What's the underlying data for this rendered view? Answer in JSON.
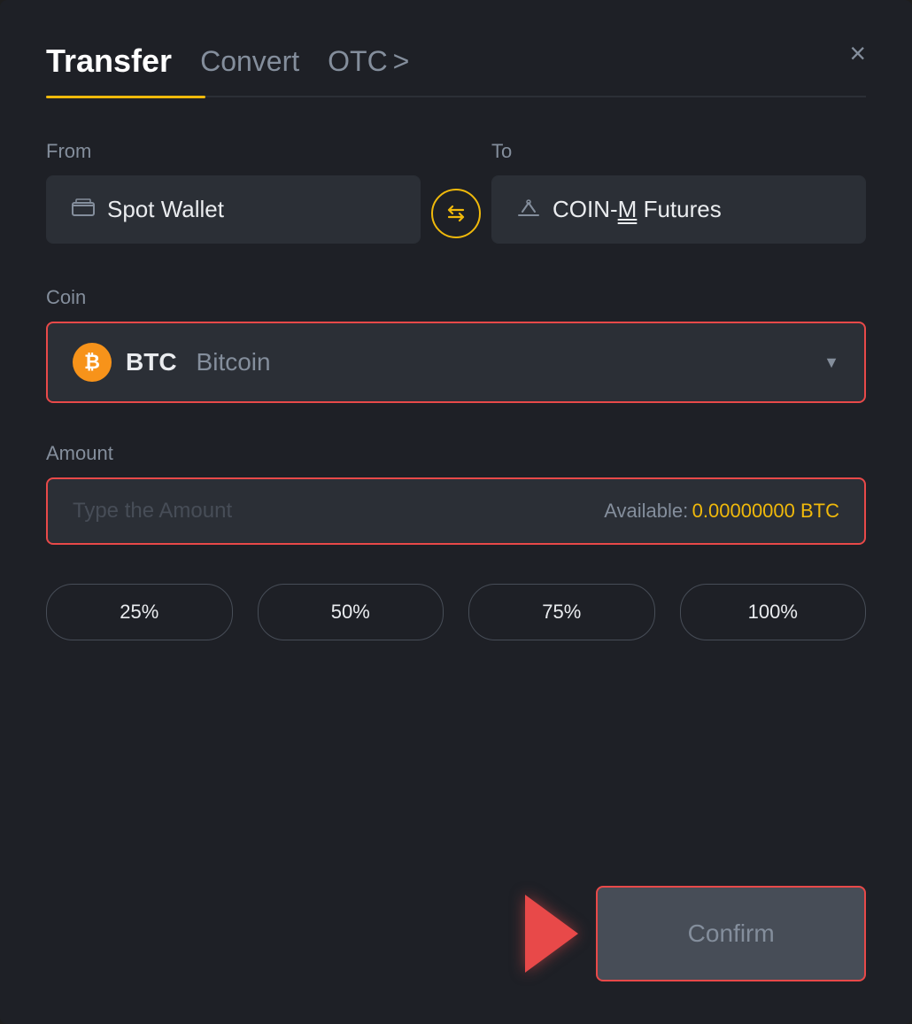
{
  "header": {
    "tab_transfer": "Transfer",
    "tab_convert": "Convert",
    "tab_otc": "OTC",
    "otc_chevron": ">",
    "close_label": "×"
  },
  "from": {
    "label": "From",
    "wallet_icon": "▬",
    "wallet_name": "Spot Wallet"
  },
  "to": {
    "label": "To",
    "wallet_icon": "↑",
    "wallet_name": "COIN-M Futures"
  },
  "swap": {
    "icon": "⇄"
  },
  "coin": {
    "label": "Coin",
    "symbol": "BTC",
    "name": "Bitcoin",
    "btc_char": "₿"
  },
  "amount": {
    "label": "Amount",
    "placeholder": "Type the Amount",
    "available_label": "Available:",
    "available_value": "0.00000000 BTC"
  },
  "percentages": [
    {
      "label": "25%"
    },
    {
      "label": "50%"
    },
    {
      "label": "75%"
    },
    {
      "label": "100%"
    }
  ],
  "confirm": {
    "label": "Confirm"
  }
}
